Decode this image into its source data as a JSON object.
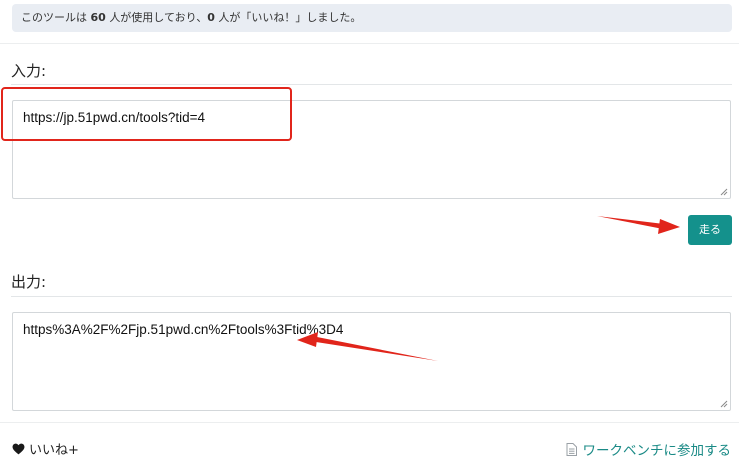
{
  "info_bar": {
    "prefix": "このツールは",
    "user_count": "60",
    "middle": "人が使用しており、",
    "like_count": "0",
    "suffix": "人が「いいね！」しました。"
  },
  "input_section": {
    "title": "入力:",
    "value": "https://jp.51pwd.cn/tools?tid=4"
  },
  "run_button": {
    "label": "走る"
  },
  "output_section": {
    "title": "出力:",
    "value": "https%3A%2F%2Fjp.51pwd.cn%2Ftools%3Ftid%3D4"
  },
  "footer": {
    "like_label": "いいね+",
    "workbench_label": "ワークベンチに参加する"
  },
  "colors": {
    "accent": "#14918c",
    "annotation": "#e1251b",
    "info_bg": "#e9edf3"
  }
}
